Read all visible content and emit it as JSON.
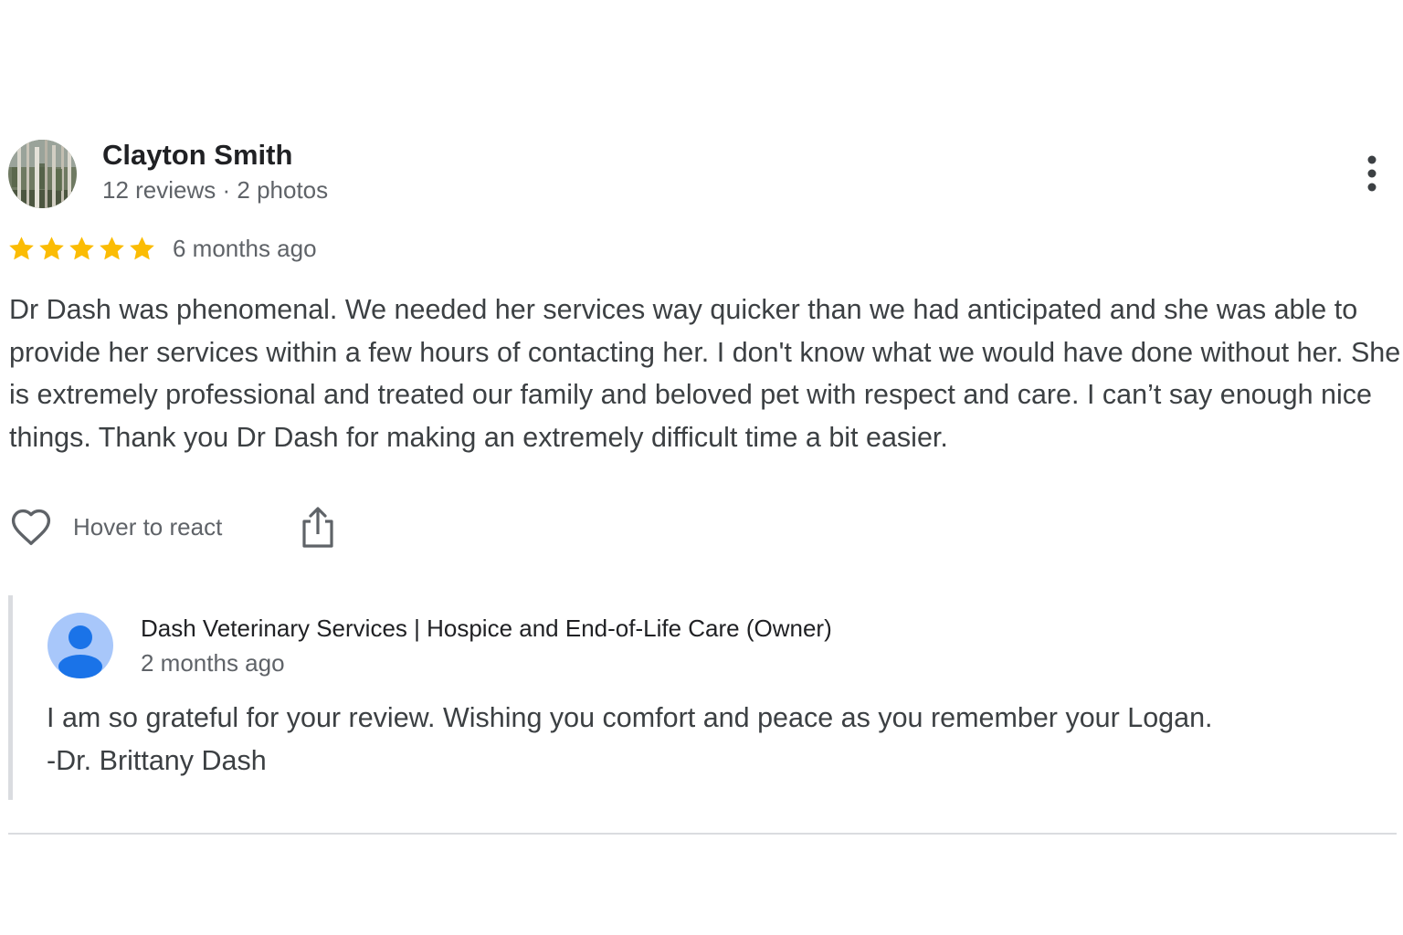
{
  "review": {
    "author": {
      "name": "Clayton Smith",
      "meta": "12 reviews · 2 photos"
    },
    "rating": 5,
    "rating_max": 5,
    "date": "6 months ago",
    "text": "Dr Dash was phenomenal. We needed her services way quicker than we had anticipated and she was able to provide her services within a few hours of contacting her. I don't know what we would have done without her. She is extremely professional and treated our family and beloved pet with respect and care. I can’t say enough nice things. Thank you Dr Dash for making an extremely difficult time a bit easier.",
    "actions": {
      "react_label": "Hover to react"
    }
  },
  "owner_reply": {
    "name": "Dash Veterinary Services | Hospice and End-of-Life Care (Owner)",
    "date": "2 months ago",
    "lines": [
      "I am so grateful for your review. Wishing you comfort and peace as you remember your Logan.",
      "-Dr. Brittany Dash"
    ]
  },
  "colors": {
    "star": "#fbbc04",
    "owner_avatar_bg": "#a8c7fa",
    "owner_avatar_fg": "#1a73e8",
    "secondary_text": "#5f6368",
    "body_text": "#3c4043",
    "divider": "#dadce0"
  },
  "icons": {
    "more": "more-vert-icon",
    "react": "heart-outline-icon",
    "share": "share-icon",
    "star": "star-icon",
    "owner_avatar": "person-icon"
  }
}
